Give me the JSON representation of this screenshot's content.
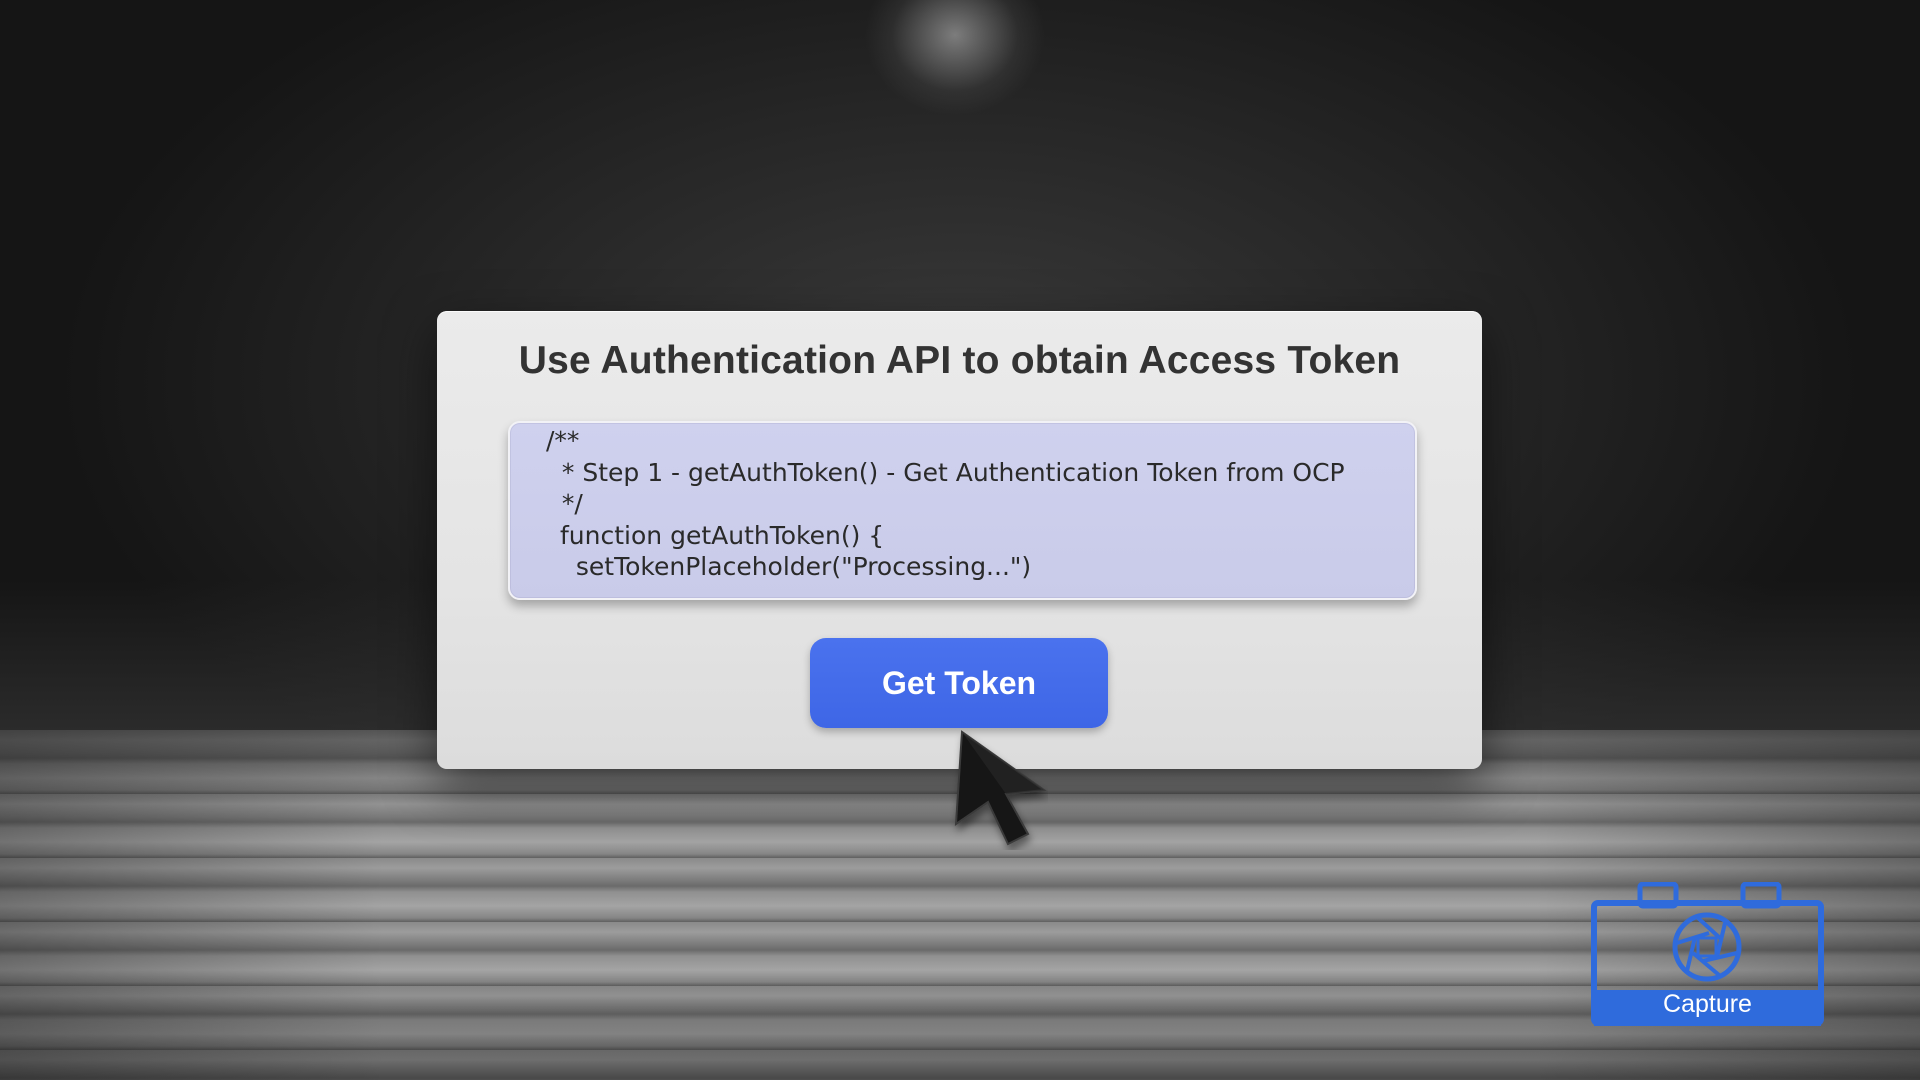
{
  "panel": {
    "title": "Use Authentication API to obtain Access Token",
    "code_lines": [
      "/**",
      "  * Step 1 - getAuthToken() - Get Authentication Token from OCP",
      "  */",
      "function getAuthToken() {",
      "  setTokenPlaceholder(\"Processing...\")"
    ],
    "button_label": "Get Token"
  },
  "capture": {
    "label": "Capture",
    "icon": "camera-aperture-icon"
  },
  "colors": {
    "button": "#3e66e6",
    "code_background": "#cbcdea",
    "capture": "#2f6bdc"
  }
}
